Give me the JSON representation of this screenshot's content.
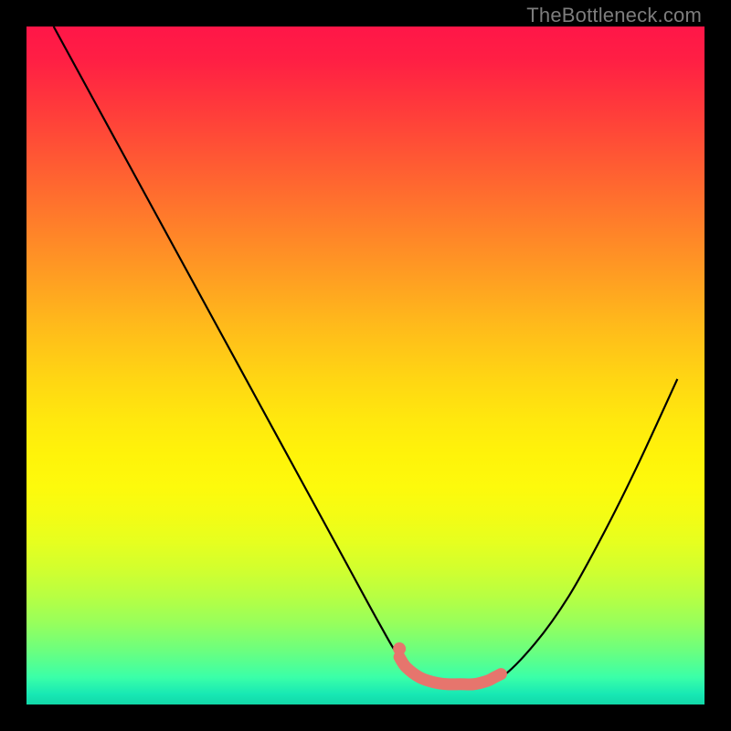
{
  "watermark": "TheBottleneck.com",
  "chart_data": {
    "type": "line",
    "title": "",
    "xlabel": "",
    "ylabel": "",
    "xlim": [
      0,
      100
    ],
    "ylim": [
      0,
      100
    ],
    "series": [
      {
        "name": "curve",
        "color": "#000000",
        "x": [
          4,
          10,
          16,
          22,
          28,
          34,
          40,
          46,
          52,
          55,
          58,
          62,
          66,
          70,
          75,
          80,
          85,
          90,
          96
        ],
        "y": [
          100,
          89,
          78,
          67,
          56,
          45,
          34,
          23,
          12,
          7,
          4,
          3,
          3,
          4,
          9,
          16,
          25,
          35,
          48
        ]
      },
      {
        "name": "highlight",
        "color": "#e6756d",
        "x": [
          55,
          56,
          58,
          60,
          62,
          64,
          66,
          68,
          69,
          70
        ],
        "y": [
          7,
          5.5,
          4,
          3.3,
          3,
          3,
          3,
          3.5,
          4,
          4.5
        ]
      }
    ],
    "annotations": []
  }
}
